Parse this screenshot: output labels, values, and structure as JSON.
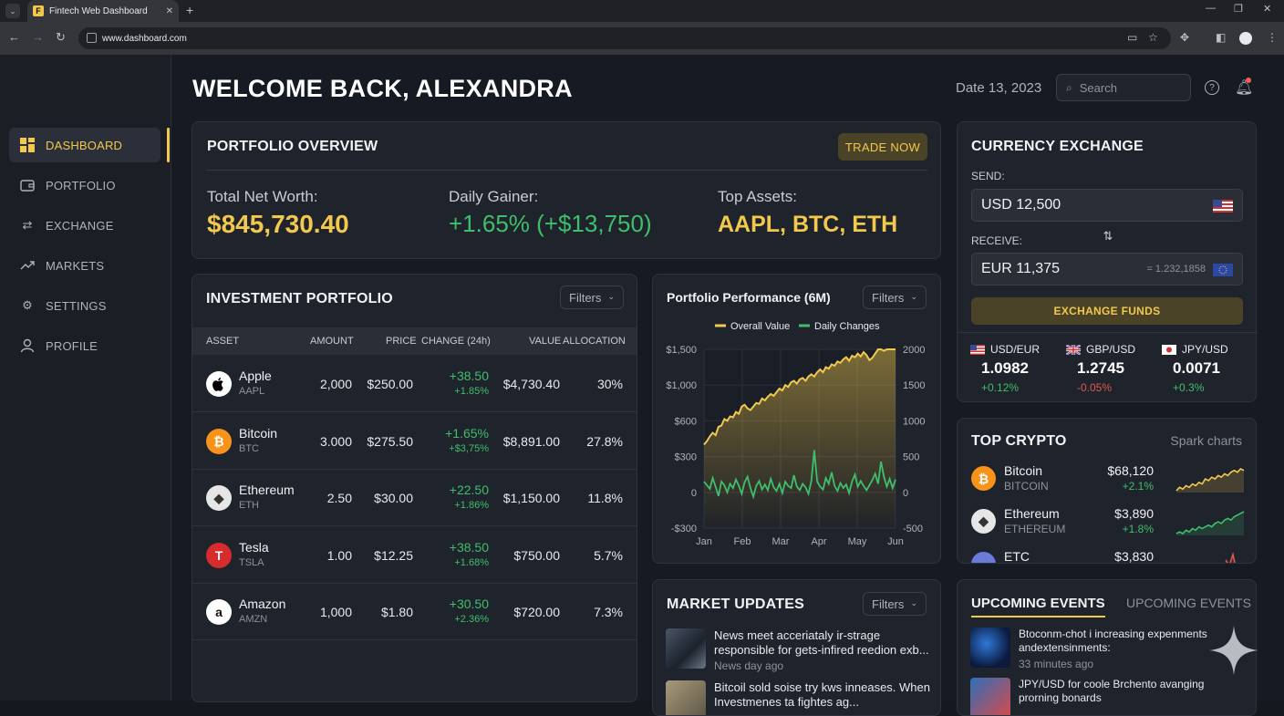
{
  "browser": {
    "tab_title": "Fintech Web Dashboard",
    "favicon_letter": "F",
    "url": "www.dashboard.com"
  },
  "sidebar": {
    "items": [
      {
        "label": "DASHBOARD",
        "icon": "grid-icon",
        "active": true
      },
      {
        "label": "PORTFOLIO",
        "icon": "wallet-icon"
      },
      {
        "label": "EXCHANGE",
        "icon": "exchange-arrows-icon"
      },
      {
        "label": "MARKETS",
        "icon": "trending-up-icon"
      },
      {
        "label": "SETTINGS",
        "icon": "gear-icon"
      },
      {
        "label": "PROFILE",
        "icon": "user-icon"
      }
    ]
  },
  "header": {
    "welcome": "WELCOME BACK, ALEXANDRA",
    "date": "Date 13, 2023",
    "search_placeholder": "Search"
  },
  "overview": {
    "title": "PORTFOLIO OVERVIEW",
    "trade_button": "TRADE NOW",
    "net_worth_label": "Total Net Worth:",
    "net_worth_value": "$845,730.40",
    "gainer_label": "Daily Gainer:",
    "gainer_value": "+1.65% (+$13,750)",
    "top_label": "Top Assets:",
    "top_value": "AAPL, BTC, ETH"
  },
  "investments": {
    "title": "INVESTMENT PORTFOLIO",
    "filters": "Filters",
    "headers": {
      "asset": "ASSET",
      "amount": "AMOUNT",
      "price": "PRICE",
      "change": "CHANGE (24h)",
      "value": "VALUE",
      "allocation": "ALLOCATION"
    },
    "rows": [
      {
        "name": "Apple",
        "ticker": "AAPL",
        "amount": "2,000",
        "price": "$250.00",
        "change": "+38.50",
        "change_pct": "+1.85%",
        "value": "$4,730.40",
        "allocation": "30%"
      },
      {
        "name": "Bitcoin",
        "ticker": "BTC",
        "amount": "3.000",
        "price": "$275.50",
        "change": "+1.65%",
        "change_pct": "+$3,75%",
        "value": "$8,891.00",
        "allocation": "27.8%"
      },
      {
        "name": "Ethereum",
        "ticker": "ETH",
        "amount": "2.50",
        "price": "$30.00",
        "change": "+22.50",
        "change_pct": "+1.86%",
        "value": "$1,150.00",
        "allocation": "11.8%"
      },
      {
        "name": "Tesla",
        "ticker": "TSLA",
        "amount": "1.00",
        "price": "$12.25",
        "change": "+38.50",
        "change_pct": "+1.68%",
        "value": "$750.00",
        "allocation": "5.7%"
      },
      {
        "name": "Amazon",
        "ticker": "AMZN",
        "amount": "1,000",
        "price": "$1.80",
        "change": "+30.50",
        "change_pct": "+2.36%",
        "value": "$720.00",
        "allocation": "7.3%"
      }
    ]
  },
  "performance": {
    "title": "Portfolio Performance (6M)",
    "filters": "Filters",
    "legend_value": "Overall Value",
    "legend_daily": "Daily Changes"
  },
  "chart_data": {
    "type": "line",
    "title": "Portfolio Performance (6M)",
    "x_ticks": [
      "Jan",
      "Feb",
      "Mar",
      "Apr",
      "May",
      "Jun"
    ],
    "y_left_ticks": [
      "$1,500",
      "$1,000",
      "$600",
      "$300",
      "0",
      "-$300"
    ],
    "y_right_ticks": [
      "2000",
      "1500",
      "1000",
      "500",
      "0",
      "-500"
    ],
    "ylim_left": [
      -300,
      1500
    ],
    "ylim_right": [
      -500,
      2000
    ],
    "grid": true,
    "legend": "top-center",
    "series": [
      {
        "name": "Overall Value",
        "axis": "left",
        "color": "#f2c94c",
        "values": [
          400,
          430,
          470,
          500,
          480,
          550,
          560,
          620,
          600,
          650,
          640,
          700,
          680,
          760,
          780,
          740,
          720,
          760,
          800,
          790,
          850,
          830,
          870,
          900,
          880,
          920,
          960,
          940,
          1000,
          980,
          1040,
          1060,
          1020,
          1080,
          1100,
          1060,
          1120,
          1150,
          1120,
          1180,
          1220,
          1180,
          1250,
          1230,
          1290,
          1270,
          1330,
          1310,
          1360,
          1390,
          1340,
          1410,
          1390,
          1440,
          1400,
          1460,
          1420,
          1350,
          1380,
          1440,
          1500,
          1520,
          1480,
          1540,
          1600,
          1560,
          1650
        ]
      },
      {
        "name": "Daily Changes",
        "axis": "right",
        "color": "#3fbf6a",
        "values": [
          150,
          100,
          50,
          200,
          80,
          -50,
          150,
          100,
          0,
          120,
          60,
          180,
          90,
          -20,
          140,
          220,
          60,
          -60,
          90,
          160,
          40,
          110,
          30,
          190,
          70,
          20,
          120,
          -10,
          150,
          90,
          60,
          240,
          80,
          30,
          120,
          70,
          -20,
          160,
          590,
          150,
          80,
          40,
          200,
          120,
          280,
          90,
          20,
          130,
          60,
          110,
          -10,
          150,
          250,
          80,
          160,
          90,
          30,
          100,
          170,
          260,
          120,
          430,
          220,
          80,
          190,
          60,
          180
        ]
      }
    ]
  },
  "currency": {
    "title": "CURRENCY EXCHANGE",
    "send_label": "SEND:",
    "send_value": "USD 12,500",
    "receive_label": "RECEIVE:",
    "receive_value": "EUR 11,375",
    "rate": "= 1.232,1858",
    "button": "EXCHANGE FUNDS",
    "pairs": [
      {
        "pair": "USD/EUR",
        "value": "1.0982",
        "change": "+0.12%",
        "up": true
      },
      {
        "pair": "GBP/USD",
        "value": "1.2745",
        "change": "-0.05%",
        "up": false
      },
      {
        "pair": "JPY/USD",
        "value": "0.0071",
        "change": "+0.3%",
        "up": true
      }
    ]
  },
  "crypto": {
    "title": "TOP CRYPTO",
    "subtitle": "Spark charts",
    "items": [
      {
        "name": "Bitcoin",
        "ticker": "BITCOIN",
        "price": "$68,120",
        "change": "+2.1%",
        "color": "#f2c94c"
      },
      {
        "name": "Ethereum",
        "ticker": "ETHEREUM",
        "price": "$3,890",
        "change": "+1.8%",
        "color": "#3fbf6a"
      },
      {
        "name": "ETC",
        "ticker": "",
        "price": "$3,830",
        "change": "",
        "color": "#e0574f"
      }
    ]
  },
  "market_updates": {
    "title": "MARKET UPDATES",
    "filters": "Filters",
    "items": [
      {
        "title": "News meet acceriataly ir-strage responsible for gets-infired reedion exb...",
        "meta": "News day ago"
      },
      {
        "title": "Bitcoil sold soise try kws inneases. When Investmenes ta fightes ag...",
        "meta": ""
      }
    ]
  },
  "events": {
    "tab_active": "UPCOMING EVENTS",
    "tab_inactive": "UPCOMING EVENTS",
    "items": [
      {
        "title": "Btoconm-chot i increasing expenments andextensinments:",
        "meta": "33 minutes ago"
      },
      {
        "title": "JPY/USD for coole Brchento avanging prorning bonards",
        "meta": ""
      }
    ]
  }
}
